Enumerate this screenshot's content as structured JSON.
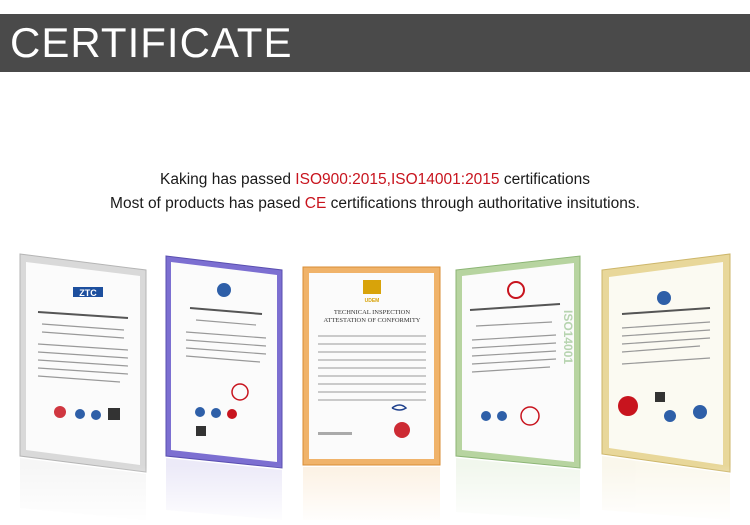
{
  "banner": {
    "title": "CERTIFICATE",
    "background": "#4a4a4a"
  },
  "intro": {
    "line1_before": "Kaking has passed ",
    "line1_highlight": "ISO900:2015,ISO14001:2015",
    "line1_after": " certifications",
    "line2_before": "Most of products has pased ",
    "line2_highlight": "CE",
    "line2_after": " certifications through authoritative insitutions.",
    "highlight_color": "#c8141e"
  },
  "certificates": [
    {
      "frame": "silver",
      "emblem": "ZTC",
      "emblem_color": "#1d4f9e"
    },
    {
      "frame": "purple-blue",
      "emblem": "globe",
      "emblem_color": "#2e5fa8"
    },
    {
      "frame": "orange",
      "emblem": "UDEM",
      "emblem_color": "#d8a30a",
      "header1": "TECHNICAL INSPECTION",
      "header2": "ATTESTATION OF CONFORMITY"
    },
    {
      "frame": "green",
      "emblem": "seal",
      "emblem_color": "#c8141e",
      "side_text": "ISO14001"
    },
    {
      "frame": "gold",
      "emblem": "globe",
      "emblem_color": "#2e5fa8"
    }
  ]
}
